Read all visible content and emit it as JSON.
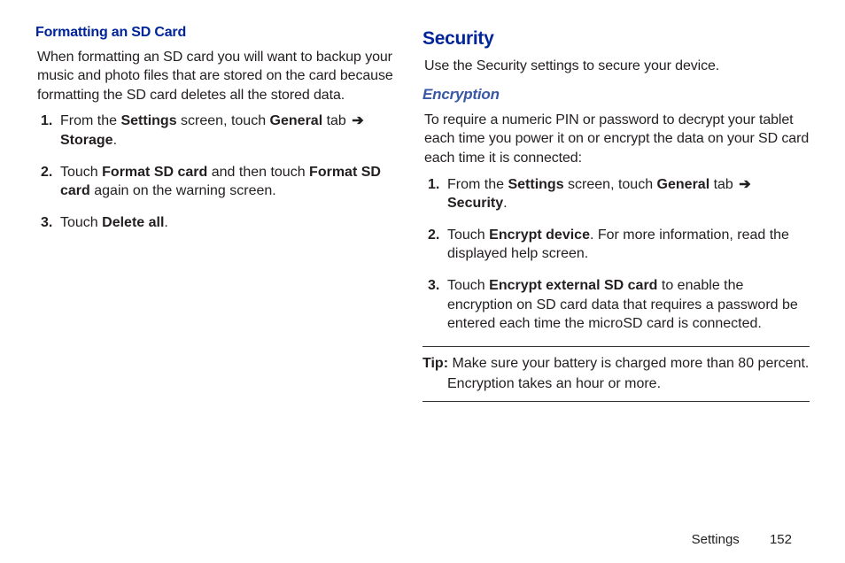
{
  "left": {
    "heading": "Formatting an SD Card",
    "intro": "When formatting an SD card you will want to backup your music and photo files that are stored on the card because formatting the SD card deletes all the stored data.",
    "steps": [
      {
        "num": "1.",
        "parts": [
          {
            "t": "From the "
          },
          {
            "b": "Settings"
          },
          {
            "t": " screen, touch "
          },
          {
            "b": "General"
          },
          {
            "t": " tab "
          },
          {
            "arrow": "➔"
          },
          {
            "t": " "
          },
          {
            "b": "Storage"
          },
          {
            "t": "."
          }
        ]
      },
      {
        "num": "2.",
        "parts": [
          {
            "t": "Touch "
          },
          {
            "b": "Format SD card"
          },
          {
            "t": " and then touch "
          },
          {
            "b": "Format SD card"
          },
          {
            "t": " again on the warning screen."
          }
        ]
      },
      {
        "num": "3.",
        "parts": [
          {
            "t": "Touch "
          },
          {
            "b": "Delete all"
          },
          {
            "t": "."
          }
        ]
      }
    ]
  },
  "right": {
    "heading": "Security",
    "intro": "Use the Security settings to secure your device.",
    "sub": "Encryption",
    "sub_intro": "To require a numeric PIN or password to decrypt your tablet each time you power it on or encrypt the data on your SD card each time it is connected:",
    "steps": [
      {
        "num": "1.",
        "parts": [
          {
            "t": "From the "
          },
          {
            "b": "Settings"
          },
          {
            "t": " screen, touch "
          },
          {
            "b": "General"
          },
          {
            "t": " tab "
          },
          {
            "arrow": "➔"
          },
          {
            "t": " "
          },
          {
            "b": "Security"
          },
          {
            "t": "."
          }
        ]
      },
      {
        "num": "2.",
        "parts": [
          {
            "t": "Touch "
          },
          {
            "b": "Encrypt device"
          },
          {
            "t": ". For more information, read the displayed help screen."
          }
        ]
      },
      {
        "num": "3.",
        "parts": [
          {
            "t": "Touch "
          },
          {
            "b": "Encrypt external SD card"
          },
          {
            "t": " to enable the encryption on SD card data that requires a password be entered each time the microSD card is connected."
          }
        ]
      }
    ],
    "tip_label": "Tip:",
    "tip_line1": "Make sure your battery is charged more than 80 percent.",
    "tip_line2": "Encryption takes an hour or more."
  },
  "footer": {
    "section": "Settings",
    "page": "152"
  }
}
